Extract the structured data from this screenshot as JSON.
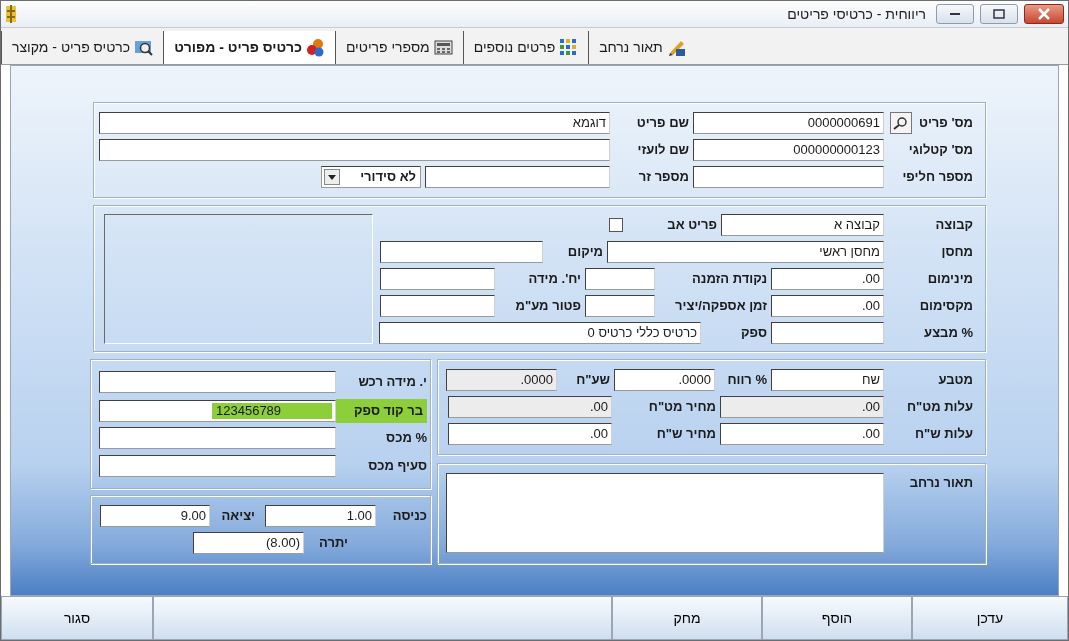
{
  "window": {
    "title": "ריווחית - כרטיסי פריטים"
  },
  "tabs": [
    {
      "label": "תאור נרחב",
      "selected": false
    },
    {
      "label": "פרטים נוספים",
      "selected": false
    },
    {
      "label": "מספרי פריטים",
      "selected": false
    },
    {
      "label": "כרטיס פריט - מפורט",
      "selected": true
    },
    {
      "label": "כרטיס פריט - מקוצר",
      "selected": false
    }
  ],
  "identity_panel": {
    "rows": [
      {
        "items": [
          {
            "kind": "label",
            "text": "מס' פריט"
          },
          {
            "kind": "search"
          },
          {
            "kind": "field",
            "value": "0000000691"
          },
          {
            "kind": "label",
            "text": "שם פריט"
          },
          {
            "kind": "field",
            "value": "דוגמא"
          }
        ]
      },
      {
        "items": [
          {
            "kind": "label",
            "text": "מס' קטלוגי"
          },
          {
            "kind": "field",
            "value": "000000000123"
          },
          {
            "kind": "label",
            "text": "שם לועזי"
          },
          {
            "kind": "field"
          }
        ]
      },
      {
        "items": [
          {
            "kind": "label",
            "text": "מספר חליפי"
          },
          {
            "kind": "field"
          },
          {
            "kind": "label",
            "text": "מספר זר"
          },
          {
            "kind": "field"
          },
          {
            "kind": "dropdown",
            "value": "לא סידורי"
          }
        ]
      }
    ]
  },
  "stock_panel": {
    "rows": [
      {
        "items": [
          {
            "kind": "label",
            "text": "קבוצה"
          },
          {
            "kind": "field",
            "value": "קבוצה א"
          },
          {
            "kind": "label",
            "text": "פריט אב"
          },
          {
            "kind": "checkbox",
            "checked": false
          }
        ]
      },
      {
        "items": [
          {
            "kind": "label",
            "text": "מחסן"
          },
          {
            "kind": "field",
            "value": "מחסן ראשי"
          },
          {
            "kind": "label",
            "text": "מיקום"
          },
          {
            "kind": "field"
          }
        ]
      },
      {
        "items": [
          {
            "kind": "label",
            "text": "מינימום"
          },
          {
            "kind": "field",
            "value": ".00"
          },
          {
            "kind": "label",
            "text": "נקודת הזמנה"
          },
          {
            "kind": "field"
          },
          {
            "kind": "label",
            "text": "יח'. מידה"
          },
          {
            "kind": "field"
          }
        ]
      },
      {
        "items": [
          {
            "kind": "label",
            "text": "מקסימום"
          },
          {
            "kind": "field",
            "value": ".00"
          },
          {
            "kind": "label",
            "text": "זמן אספקה/יציר"
          },
          {
            "kind": "field"
          },
          {
            "kind": "label",
            "text": "פטור מע\"מ"
          },
          {
            "kind": "field"
          }
        ]
      },
      {
        "items": [
          {
            "kind": "label",
            "text": "% מבצע"
          },
          {
            "kind": "field"
          },
          {
            "kind": "label",
            "text": "ספק"
          },
          {
            "kind": "field",
            "value": "כרטיס כללי כרטיס 0"
          }
        ]
      }
    ]
  },
  "price_panel": {
    "rows": [
      {
        "items": [
          {
            "kind": "label",
            "text": "מטבע"
          },
          {
            "kind": "field",
            "value": "שח"
          },
          {
            "kind": "label",
            "text": "% רווח"
          },
          {
            "kind": "field",
            "value": ".0000"
          },
          {
            "kind": "label",
            "text": "שע\"ח"
          },
          {
            "kind": "readonly_field",
            "value": ".0000"
          }
        ]
      },
      {
        "items": [
          {
            "kind": "label",
            "text": "עלות מט\"ח"
          },
          {
            "kind": "readonly_field",
            "value": ".00"
          },
          {
            "kind": "label",
            "text": "מחיר מט\"ח"
          },
          {
            "kind": "readonly_field",
            "value": ".00"
          }
        ]
      },
      {
        "items": [
          {
            "kind": "label",
            "text": "עלות ש\"ח"
          },
          {
            "kind": "field",
            "value": ".00"
          },
          {
            "kind": "label",
            "text": "מחיר ש\"ח"
          },
          {
            "kind": "field",
            "value": ".00"
          }
        ]
      }
    ]
  },
  "barcode_panel": {
    "rows": [
      {
        "items": [
          {
            "kind": "label",
            "text": "י. מידה רכש"
          },
          {
            "kind": "field"
          }
        ]
      },
      {
        "items": [
          {
            "kind": "highlight_label",
            "text": "בר קוד ספק"
          },
          {
            "kind": "highlight_field",
            "value": "123456789"
          }
        ]
      },
      {
        "items": [
          {
            "kind": "label",
            "text": "% מכס"
          },
          {
            "kind": "field"
          }
        ]
      },
      {
        "items": [
          {
            "kind": "label",
            "text": "סעיף מכס"
          },
          {
            "kind": "field"
          }
        ]
      }
    ]
  },
  "description_panel": {
    "rows": [
      {
        "items": [
          {
            "kind": "label",
            "text": "תאור נרחב"
          },
          {
            "kind": "textarea"
          }
        ]
      }
    ]
  },
  "balance_panel": {
    "rows": [
      {
        "items": [
          {
            "kind": "label",
            "text": "כניסה"
          },
          {
            "kind": "field",
            "value": "1.00"
          },
          {
            "kind": "label",
            "text": "יציאה"
          },
          {
            "kind": "field",
            "value": "9.00"
          }
        ]
      },
      {
        "items": [
          {
            "kind": "label",
            "text": "יתרה"
          },
          {
            "kind": "field",
            "value": "(8.00)"
          }
        ]
      }
    ]
  },
  "buttons": [
    {
      "label": "עדכן"
    },
    {
      "label": "הוסף"
    },
    {
      "label": "מחק"
    },
    {
      "label": "סגור"
    }
  ]
}
